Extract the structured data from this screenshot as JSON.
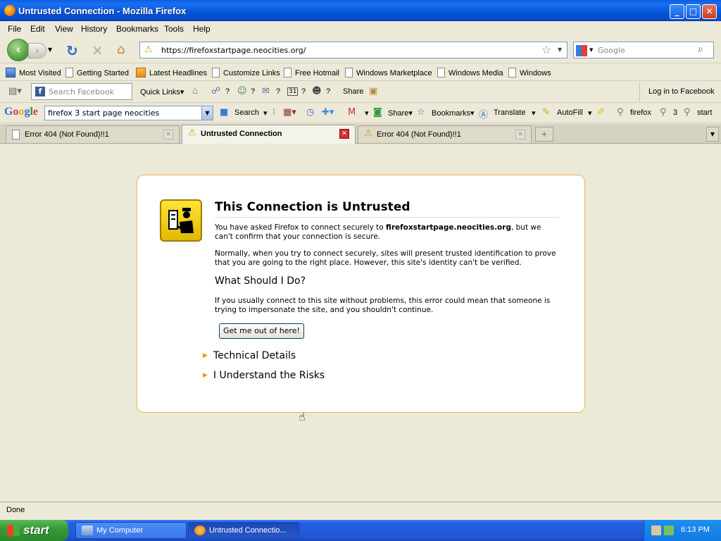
{
  "window": {
    "title": "Untrusted Connection - Mozilla Firefox",
    "min_glyph": "_",
    "max_glyph": "□",
    "close_glyph": "✕"
  },
  "menu": [
    "File",
    "Edit",
    "View",
    "History",
    "Bookmarks",
    "Tools",
    "Help"
  ],
  "nav": {
    "url": "https://firefoxstartpage.neocities.org/",
    "search_placeholder": "Google"
  },
  "bookmarks": [
    {
      "label": "Most Visited",
      "icon": "most-visited-icon"
    },
    {
      "label": "Getting Started",
      "icon": "page-icon"
    },
    {
      "label": "Latest Headlines",
      "icon": "rss-icon"
    },
    {
      "label": "Customize Links",
      "icon": "page-icon"
    },
    {
      "label": "Free Hotmail",
      "icon": "page-icon"
    },
    {
      "label": "Windows Marketplace",
      "icon": "page-icon"
    },
    {
      "label": "Windows Media",
      "icon": "page-icon"
    },
    {
      "label": "Windows",
      "icon": "page-icon"
    }
  ],
  "facebook_toolbar": {
    "search_placeholder": "Search Facebook",
    "quick_links": "Quick Links",
    "q1": "?",
    "q2": "?",
    "q3": "?",
    "q4": "?",
    "q5": "?",
    "calendar_day": "31",
    "share": "Share",
    "login": "Log in to Facebook"
  },
  "google_toolbar": {
    "query": "firefox 3 start page neocities",
    "search": "Search",
    "share": "Share",
    "bookmarks": "Bookmarks",
    "translate": "Translate",
    "autofill": "AutoFill",
    "term1": "firefox",
    "term2": "3",
    "term3": "start"
  },
  "tabs": [
    {
      "label": "Error 404 (Not Found)!!1",
      "active": false
    },
    {
      "label": "Untrusted Connection",
      "active": true
    },
    {
      "label": "Error 404 (Not Found)!!1",
      "active": false
    }
  ],
  "error_page": {
    "title": "This Connection is Untrusted",
    "p1_pre": "You have asked Firefox to connect securely to ",
    "p1_host": "firefoxstartpage.neocities.org",
    "p1_post": ", but we can't confirm that your connection is secure.",
    "p2": "Normally, when you try to connect securely, sites will present trusted identification to prove that you are going to the right place. However, this site's identity can't be verified.",
    "what_title": "What Should I Do?",
    "p3": "If you usually connect to this site without problems, this error could mean that someone is trying to impersonate the site, and you shouldn't continue.",
    "button": "Get me out of here!",
    "technical": "Technical Details",
    "risks": "I Understand the Risks"
  },
  "status": "Done",
  "taskbar": {
    "start": "start",
    "tasks": [
      "My Computer",
      "Untrusted Connectio..."
    ],
    "clock": "6:13 PM"
  },
  "colors": {
    "xp_blue": "#245ee0",
    "warning_yellow": "#ffe43a",
    "box_border": "#e8b84a"
  }
}
